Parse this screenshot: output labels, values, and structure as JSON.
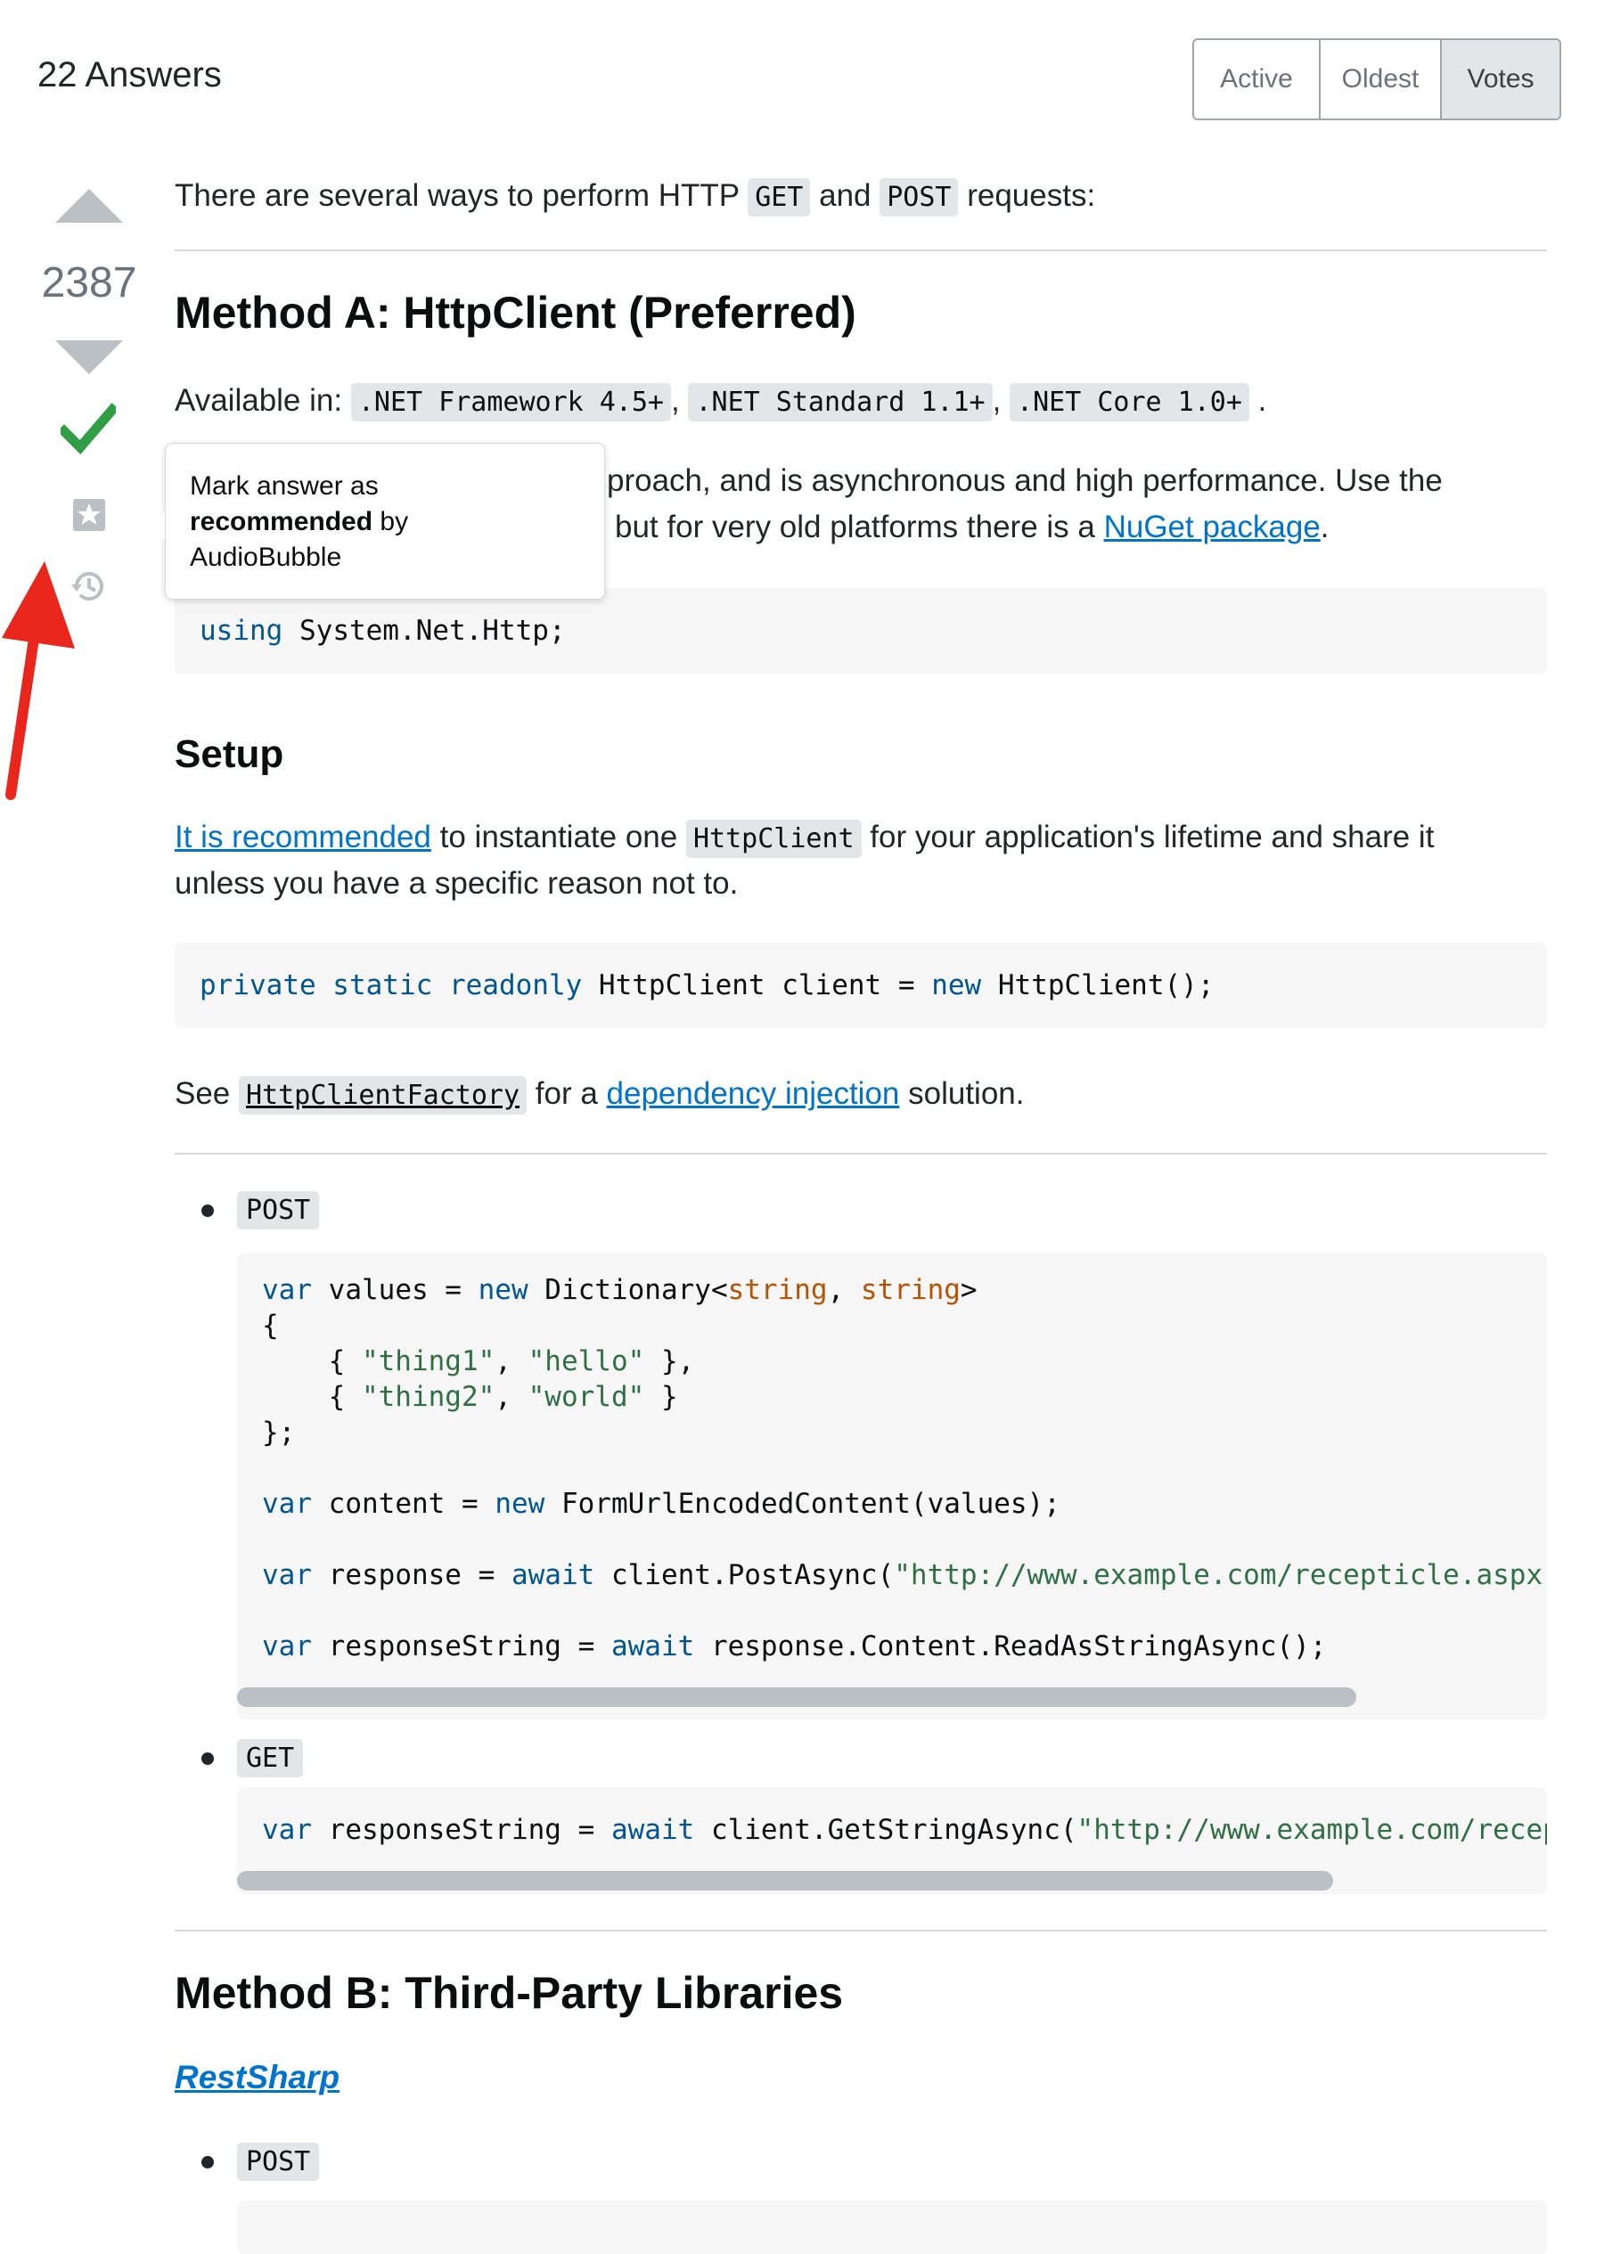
{
  "header": {
    "answers_count": "22 Answers",
    "sort_tabs": [
      {
        "label": "Active",
        "selected": false
      },
      {
        "label": "Oldest",
        "selected": false
      },
      {
        "label": "Votes",
        "selected": true
      }
    ]
  },
  "votes": {
    "score": "2387",
    "upvote_icon": "caret-up-icon",
    "downvote_icon": "caret-down-icon",
    "accepted_icon": "checkmark-icon",
    "bookmark_icon": "bookmark-star-icon",
    "history_icon": "history-icon"
  },
  "tooltip": {
    "line1": "Mark answer as",
    "bold": "recommended",
    "by": " by",
    "line3": "AudioBubble"
  },
  "answer": {
    "intro": {
      "before": "There are several ways to perform HTTP ",
      "code1": "GET",
      "mid": " and ",
      "code2": "POST",
      "after": " requests:"
    },
    "method_a": {
      "title": "Method A: HttpClient (Preferred)",
      "available_label": "Available in: ",
      "frameworks": [
        ".NET Framework 4.5+",
        ".NET Standard 1.1+",
        ".NET Core 1.0+"
      ],
      "comma": ", ",
      "period": " .",
      "approach_line1": "proach, and is asynchronous and high performance. Use the",
      "approach_line2": "but for very old platforms there is a ",
      "nuget_link": "NuGet package",
      "approach_end": ".",
      "using_kw": "using",
      "using_rest": " System.Net.Http;"
    },
    "setup": {
      "title": "Setup",
      "recommended_link": "It is recommended",
      "text1": " to instantiate one ",
      "code": "HttpClient",
      "text2": " for your application's lifetime and share it",
      "line2": "unless you have a specific reason not to.",
      "decl_kw": "private static readonly",
      "decl_rest": " HttpClient client = ",
      "decl_new": "new",
      "decl_end": " HttpClient();",
      "see": "See ",
      "factory_code": "HttpClientFactory",
      "for_a": " for a ",
      "di_link": "dependency injection",
      "solution": " solution."
    },
    "post": {
      "label": "POST",
      "lines": {
        "l1_var": "var",
        "l1_mid": " values = ",
        "l1_new": "new",
        "l1_dict": " Dictionary<",
        "l1_s1": "string",
        "l1_comma": ", ",
        "l1_s2": "string",
        "l1_close": ">",
        "l2": "{",
        "l3_open": "    { ",
        "l3_a": "\"thing1\"",
        "l3_comma": ", ",
        "l3_b": "\"hello\"",
        "l3_close": " },",
        "l4_open": "    { ",
        "l4_a": "\"thing2\"",
        "l4_comma": ", ",
        "l4_b": "\"world\"",
        "l4_close": " }",
        "l5": "};",
        "l6_var": "var",
        "l6_mid": " content = ",
        "l6_new": "new",
        "l6_rest": " FormUrlEncodedContent(values);",
        "l7_var": "var",
        "l7_mid": " response = ",
        "l7_await": "await",
        "l7_rest": " client.PostAsync(",
        "l7_str": "\"http://www.example.com/recepticle.aspx\"",
        "l8_var": "var",
        "l8_mid": " responseString = ",
        "l8_await": "await",
        "l8_rest": " response.Content.ReadAsStringAsync();"
      }
    },
    "get": {
      "label": "GET",
      "var": "var",
      "mid": " responseString = ",
      "await": "await",
      "rest": " client.GetStringAsync(",
      "str": "\"http://www.example.com/recepticle.aspx\""
    },
    "method_b": {
      "title": "Method B: Third-Party Libraries",
      "restsharp_link": "RestSharp",
      "post_label": "POST"
    }
  },
  "colors": {
    "link": "#0074cc",
    "accepted": "#2f9e44",
    "arrow": "#e8261b",
    "keyword": "#015692",
    "string": "#2f6f44"
  }
}
